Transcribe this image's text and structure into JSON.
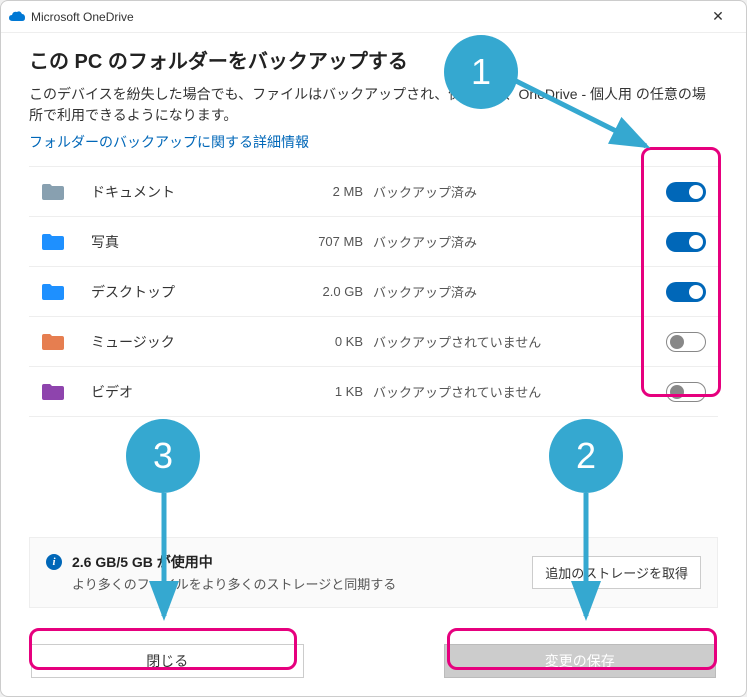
{
  "titlebar": {
    "title": "Microsoft OneDrive"
  },
  "main": {
    "heading": "この PC のフォルダーをバックアップする",
    "description": "このデバイスを紛失した場合でも、ファイルはバックアップされ、保護され、OneDrive - 個人用 の任意の場所で利用できるようになります。",
    "link": "フォルダーのバックアップに関する詳細情報"
  },
  "folders": [
    {
      "name": "ドキュメント",
      "size": "2 MB",
      "status": "バックアップ済み",
      "on": true,
      "iconColor": "#88a0b0"
    },
    {
      "name": "写真",
      "size": "707 MB",
      "status": "バックアップ済み",
      "on": true,
      "iconColor": "#1e90ff"
    },
    {
      "name": "デスクトップ",
      "size": "2.0 GB",
      "status": "バックアップ済み",
      "on": true,
      "iconColor": "#1e90ff"
    },
    {
      "name": "ミュージック",
      "size": "0 KB",
      "status": "バックアップされていません",
      "on": false,
      "iconColor": "#e67e50"
    },
    {
      "name": "ビデオ",
      "size": "1 KB",
      "status": "バックアップされていません",
      "on": false,
      "iconColor": "#8e44ad"
    }
  ],
  "storage": {
    "title": "2.6 GB/5 GB が使用中",
    "subtitle": "より多くのファイルをより多くのストレージと同期する",
    "button": "追加のストレージを取得"
  },
  "buttons": {
    "close": "閉じる",
    "save": "変更の保存"
  },
  "annotations": {
    "n1": "1",
    "n2": "2",
    "n3": "3"
  }
}
